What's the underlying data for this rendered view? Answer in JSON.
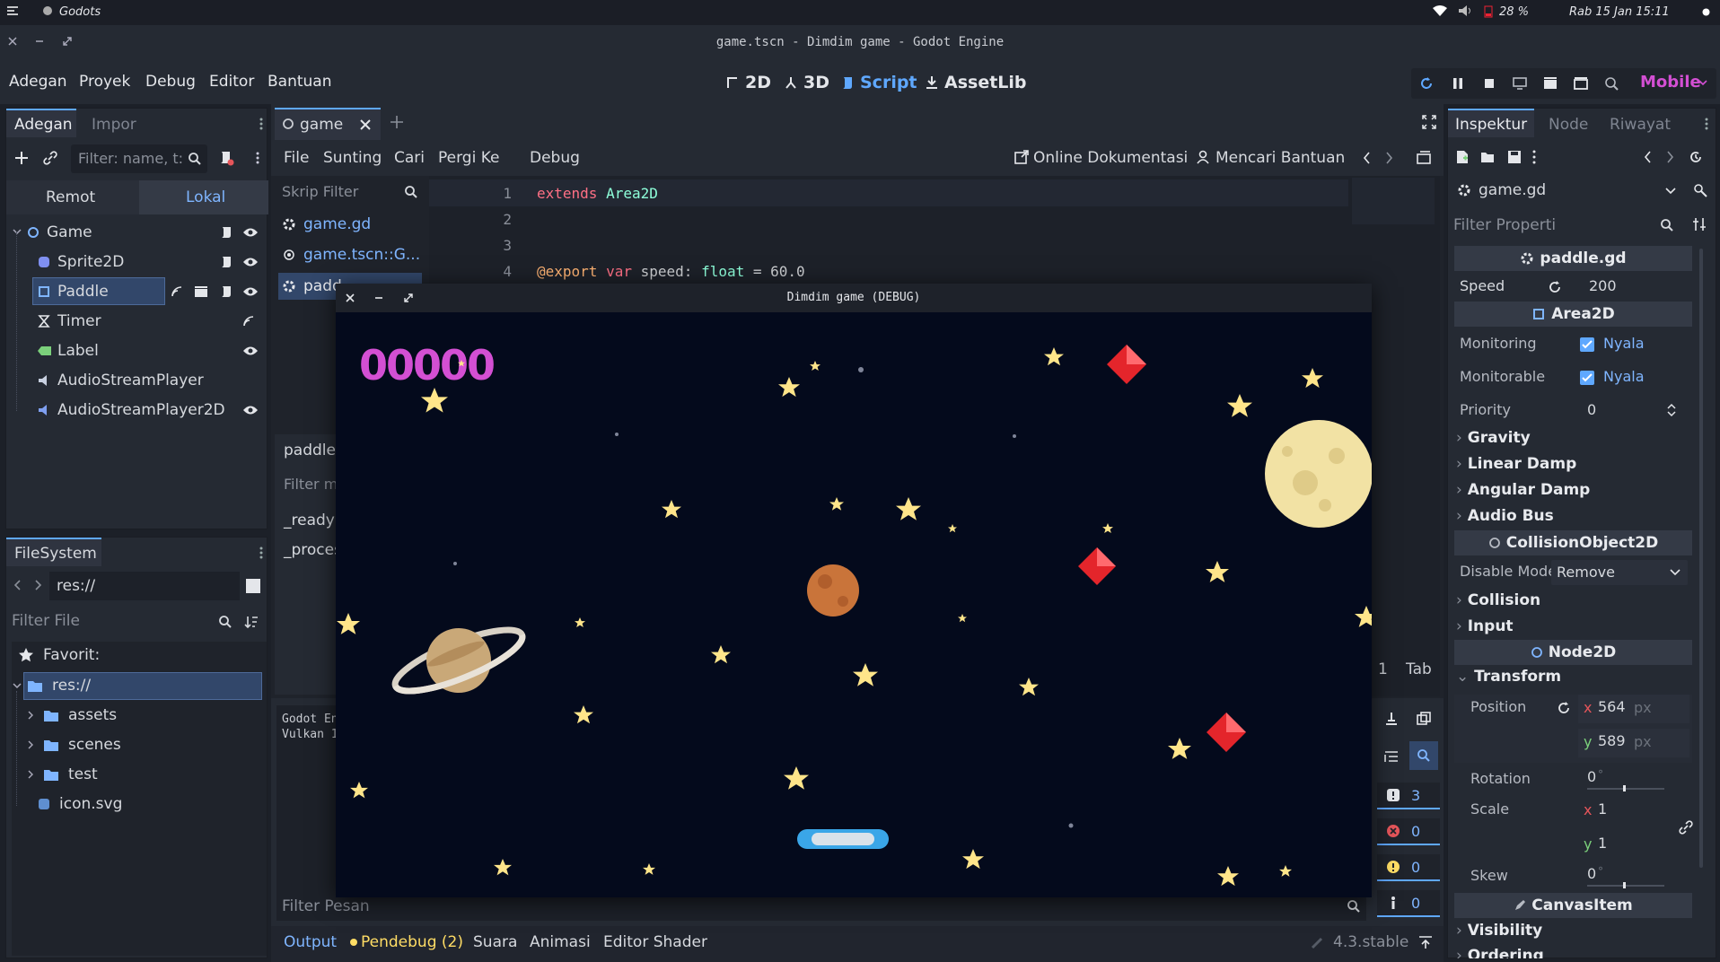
{
  "os": {
    "app_name": "Godots",
    "wifi": "wifi-icon",
    "volume": "volume-icon",
    "battery": "28 %",
    "datetime": "Rab 15 Jan 15:11"
  },
  "window": {
    "title": "game.tscn - Dimdim game - Godot Engine"
  },
  "menu": [
    "Adegan",
    "Proyek",
    "Debug",
    "Editor",
    "Bantuan"
  ],
  "workspaces": {
    "w2d": "2D",
    "w3d": "3D",
    "script": "Script",
    "assetlib": "AssetLib"
  },
  "renderer": "Mobile",
  "scene_dock": {
    "tabs": [
      "Adegan",
      "Impor"
    ],
    "filter_placeholder": "Filter: name, t:",
    "remote": "Remot",
    "local": "Lokal",
    "nodes": [
      "Game",
      "Sprite2D",
      "Paddle",
      "Timer",
      "Label",
      "AudioStreamPlayer",
      "AudioStreamPlayer2D"
    ]
  },
  "filesystem": {
    "tab": "FileSystem",
    "path": "res://",
    "filter_placeholder": "Filter File",
    "items": [
      "Favorit:",
      "res://",
      "assets",
      "scenes",
      "test",
      "icon.svg"
    ]
  },
  "editor_tabs": {
    "active": "game"
  },
  "script_menu": [
    "File",
    "Sunting",
    "Cari",
    "Pergi Ke",
    "Debug"
  ],
  "script_toolbar": {
    "docs": "Online Dokumentasi",
    "help": "Mencari Bantuan"
  },
  "script_list": {
    "filter_placeholder": "Skrip Filter",
    "items": [
      "game.gd",
      "game.tscn::G...",
      "padd"
    ],
    "current": "paddle.",
    "methods_filter": "Filter m",
    "methods": [
      "_ready",
      "_proces"
    ]
  },
  "code": {
    "lines": [
      "1",
      "2",
      "3",
      "4"
    ],
    "line1_kw": "extends",
    "line1_cls": "Area2D",
    "line4_ann": "@export",
    "line4_var": "var",
    "line4_name": "speed:",
    "line4_type": "float",
    "line4_rest": "= 60.0"
  },
  "code_status": {
    "line": "1",
    "indent": "Tab"
  },
  "output_log": [
    "Godot En",
    "Vulkan 1"
  ],
  "filter_messages": "Filter Pesan",
  "counters": [
    "3",
    "0",
    "0",
    "0"
  ],
  "bottom_tabs": [
    "Output",
    "Pendebug (2)",
    "Suara",
    "Animasi",
    "Editor Shader"
  ],
  "version": "4.3.stable",
  "game_window": {
    "title": "Dimdim game (DEBUG)",
    "score": "00000"
  },
  "inspector": {
    "tabs": [
      "Inspektur",
      "Node",
      "Riwayat"
    ],
    "resource": "game.gd",
    "filter_placeholder": "Filter Properti",
    "script_section": "paddle.gd",
    "speed_label": "Speed",
    "speed_value": "200",
    "area_section": "Area2D",
    "monitoring": "Monitoring",
    "monitoring_val": "Nyala",
    "monitorable": "Monitorable",
    "monitorable_val": "Nyala",
    "priority": "Priority",
    "priority_val": "0",
    "categories": [
      "Gravity",
      "Linear Damp",
      "Angular Damp",
      "Audio Bus"
    ],
    "collision_section": "CollisionObject2D",
    "disable_mode": "Disable Mode",
    "disable_mode_val": "Remove",
    "categories2": [
      "Collision",
      "Input"
    ],
    "node2d_section": "Node2D",
    "transform": "Transform",
    "position": "Position",
    "pos_x": "564",
    "pos_y": "589",
    "px": "px",
    "rotation": "Rotation",
    "rotation_val": "0",
    "scale": "Scale",
    "scale_x": "1",
    "scale_y": "1",
    "skew": "Skew",
    "skew_val": "0",
    "deg": "°",
    "canvas_section": "CanvasItem",
    "visibility": "Visibility",
    "ordering": "Ordering"
  },
  "colors": {
    "accent": "#5fa8ff",
    "score": "#d34fd3",
    "selected": "#32476a"
  }
}
